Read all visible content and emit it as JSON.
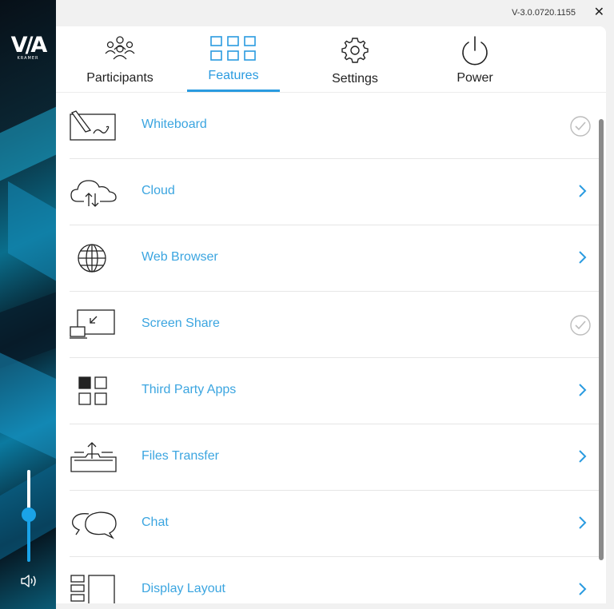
{
  "app": {
    "version": "V-3.0.0720.1155",
    "close_glyph": "✕",
    "logo_text": "V/A",
    "logo_subtext": "KRAMER"
  },
  "tabs": [
    {
      "label": "Participants",
      "icon": "participants-icon",
      "active": false
    },
    {
      "label": "Features",
      "icon": "grid-icon",
      "active": true
    },
    {
      "label": "Settings",
      "icon": "gear-icon",
      "active": false
    },
    {
      "label": "Power",
      "icon": "power-icon",
      "active": false
    }
  ],
  "features": [
    {
      "label": "Whiteboard",
      "icon": "whiteboard-icon",
      "action": "check"
    },
    {
      "label": "Cloud",
      "icon": "cloud-icon",
      "action": "chevron"
    },
    {
      "label": "Web Browser",
      "icon": "globe-icon",
      "action": "chevron"
    },
    {
      "label": "Screen Share",
      "icon": "screen-share-icon",
      "action": "check"
    },
    {
      "label": "Third Party Apps",
      "icon": "apps-icon",
      "action": "chevron"
    },
    {
      "label": "Files Transfer",
      "icon": "files-transfer-icon",
      "action": "chevron"
    },
    {
      "label": "Chat",
      "icon": "chat-icon",
      "action": "chevron"
    },
    {
      "label": "Display Layout",
      "icon": "display-layout-icon",
      "action": "chevron"
    }
  ],
  "volume": {
    "level": 0.51
  },
  "colors": {
    "accent": "#2a9be0",
    "label": "#3ba5e0"
  }
}
